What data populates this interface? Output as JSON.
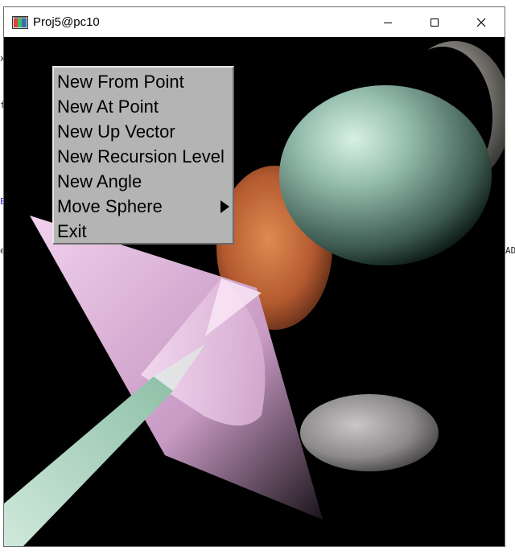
{
  "window": {
    "title": "Proj5@pc10",
    "controls": {
      "minimize": "minimize-icon",
      "maximize": "maximize-icon",
      "close": "close-icon"
    }
  },
  "background_fragments": [
    "x",
    "f",
    "E",
    "e",
    "AD"
  ],
  "menu": {
    "items": [
      {
        "label": "New From Point",
        "has_submenu": false
      },
      {
        "label": "New At Point",
        "has_submenu": false
      },
      {
        "label": "New Up Vector",
        "has_submenu": false
      },
      {
        "label": "New Recursion Level",
        "has_submenu": false
      },
      {
        "label": "New Angle",
        "has_submenu": false
      },
      {
        "label": "Move Sphere",
        "has_submenu": true
      },
      {
        "label": "Exit",
        "has_submenu": false
      }
    ]
  },
  "colors": {
    "menu_bg": "#b4b4b4",
    "canvas_bg": "#000000",
    "sphere_green": "#8fb8a8",
    "sphere_orange": "#c8683a",
    "sphere_grey": "#9a9898",
    "cone_pink": "#e8c0e0",
    "cone_green": "#a8d4bc"
  }
}
